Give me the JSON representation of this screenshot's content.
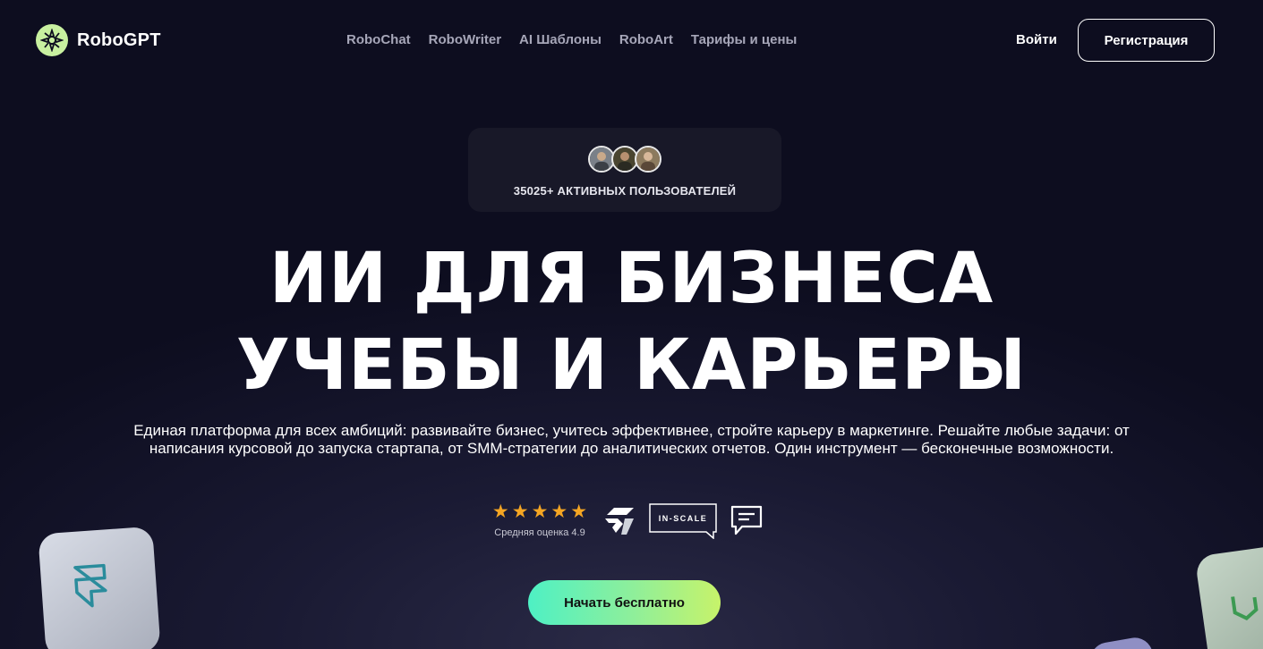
{
  "header": {
    "brand": "RoboGPT",
    "nav": [
      "RoboChat",
      "RoboWriter",
      "AI Шаблоны",
      "RoboArt",
      "Тарифы и цены"
    ],
    "login_label": "Войти",
    "register_label": "Регистрация"
  },
  "users": {
    "count_text": "35025+ АКТИВНЫХ ПОЛЬЗОВАТЕЛЕЙ"
  },
  "hero": {
    "title_line1": "ИИ ДЛЯ БИЗНЕСА",
    "title_line2": "УЧЕБЫ И КАРЬЕРЫ",
    "subtitle": "Единая платформа для всех амбиций: развивайте бизнес, учитесь эффективнее, стройте карьеру в маркетинге. Решайте любые задачи: от написания курсовой до запуска стартапа, от SMM-стратегии до аналитических отчетов. Один инструмент — бесконечные возможности."
  },
  "rating": {
    "stars": 5,
    "label": "Средняя оценка 4.9"
  },
  "partners": {
    "inscale_label": "IN-SCALE"
  },
  "cta": {
    "label": "Начать бесплатно"
  },
  "colors": {
    "background": "#0d0d1f",
    "star": "#f5a623",
    "cta_gradient_start": "#4ef0c4",
    "cta_gradient_end": "#c7f36a",
    "logo_bg": "#c8f0a0"
  },
  "icons": [
    "robogpt-logo-icon",
    "star-icon",
    "partner-logo-icon",
    "in-scale-logo",
    "chat-bubble-icon",
    "framer-icon",
    "decorative-tile"
  ]
}
